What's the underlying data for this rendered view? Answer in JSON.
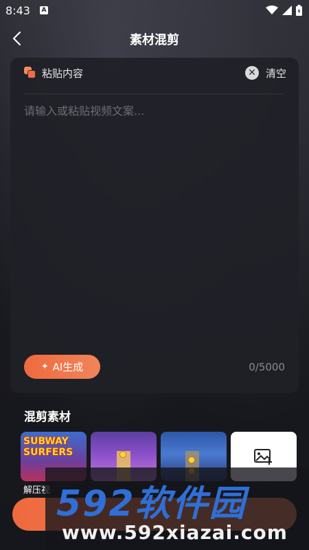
{
  "status_bar": {
    "time": "8:43",
    "notif_badge": "A"
  },
  "header": {
    "title": "素材混剪"
  },
  "editor": {
    "paste_label": "粘贴内容",
    "clear_label": "清空",
    "placeholder": "请输入或粘贴视频文案...",
    "value": "",
    "ai_button_label": "AI生成",
    "counter": "0/5000"
  },
  "materials": {
    "section_title": "混剪素材",
    "thumbnails": [
      {
        "name": "subway-surfers",
        "logo_text": "SUBWAY SURFERS"
      },
      {
        "name": "runner-corridor"
      },
      {
        "name": "runner-track"
      }
    ],
    "first_thumb_label": "解压视",
    "add_icon": "add-image-icon"
  },
  "watermark": {
    "main": "592软件园",
    "sub": "www.592xiazai.com"
  },
  "colors": {
    "accent": "#ee6a3e",
    "card": "#202127",
    "watermark_blue": "#2f6fd6"
  }
}
